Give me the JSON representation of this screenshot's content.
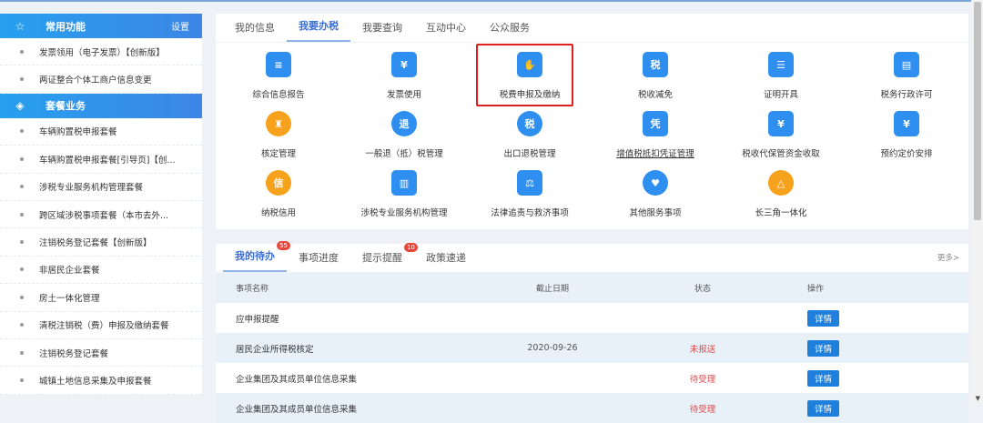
{
  "sidebar": {
    "common": {
      "title": "常用功能",
      "settings": "设置",
      "items": [
        "发票领用（电子发票）【创新版】",
        "两证整合个体工商户信息变更"
      ]
    },
    "packages": {
      "title": "套餐业务",
      "items": [
        "车辆购置税申报套餐",
        "车辆购置税申报套餐[引导页]【创...",
        "涉税专业服务机构管理套餐",
        "跨区域涉税事项套餐（本市去外...",
        "注销税务登记套餐【创新版】",
        "非居民企业套餐",
        "房土一体化管理",
        "清税注销税（费）申报及缴纳套餐",
        "注销税务登记套餐",
        "城镇土地信息采集及申报套餐"
      ]
    }
  },
  "services": {
    "tabs": [
      "我的信息",
      "我要办税",
      "我要查询",
      "互动中心",
      "公众服务"
    ],
    "active_tab": "我要办税",
    "items": [
      {
        "label": "综合信息报告",
        "icon": "report-icon",
        "glyph": "≡"
      },
      {
        "label": "发票使用",
        "icon": "invoice-icon",
        "glyph": "¥"
      },
      {
        "label": "税费申报及缴纳",
        "icon": "hand-coin-icon",
        "glyph": "✋"
      },
      {
        "label": "税收减免",
        "icon": "tax-reduction-icon",
        "glyph": "税"
      },
      {
        "label": "证明开具",
        "icon": "certificate-icon",
        "glyph": "☰"
      },
      {
        "label": "税务行政许可",
        "icon": "license-icon",
        "glyph": "▤"
      },
      {
        "label": "核定管理",
        "icon": "stamp-icon",
        "glyph": "♜"
      },
      {
        "label": "一般退（抵）税管理",
        "icon": "refund-icon",
        "glyph": "退"
      },
      {
        "label": "出口退税管理",
        "icon": "export-refund-icon",
        "glyph": "税"
      },
      {
        "label": "增值税抵扣凭证管理",
        "icon": "voucher-icon",
        "glyph": "凭"
      },
      {
        "label": "税收代保管资金收取",
        "icon": "inbox-icon",
        "glyph": "¥"
      },
      {
        "label": "预约定价安排",
        "icon": "calendar-icon",
        "glyph": "¥"
      },
      {
        "label": "纳税信用",
        "icon": "credit-medal-icon",
        "glyph": "信"
      },
      {
        "label": "涉税专业服务机构管理",
        "icon": "building-gear-icon",
        "glyph": "▥"
      },
      {
        "label": "法律追责与救济事项",
        "icon": "gavel-icon",
        "glyph": "⚖"
      },
      {
        "label": "其他服务事项",
        "icon": "heart-hands-icon",
        "glyph": "♥"
      },
      {
        "label": "长三角一体化",
        "icon": "triangle-icon",
        "glyph": "△"
      }
    ]
  },
  "todo": {
    "tabs": [
      {
        "label": "我的待办",
        "badge": "55"
      },
      {
        "label": "事项进度"
      },
      {
        "label": "提示提醒",
        "badge": "10"
      },
      {
        "label": "政策速递"
      }
    ],
    "more": "更多>",
    "columns": [
      "事项名称",
      "截止日期",
      "状态",
      "操作"
    ],
    "rows": [
      {
        "name": "应申报提醒",
        "date": "",
        "status": "",
        "action": "详情"
      },
      {
        "name": "居民企业所得税核定",
        "date": "2020-09-26",
        "status": "未报送",
        "action": "详情"
      },
      {
        "name": "企业集团及其成员单位信息采集",
        "date": "",
        "status": "待受理",
        "action": "详情"
      },
      {
        "name": "企业集团及其成员单位信息采集",
        "date": "",
        "status": "待受理",
        "action": "详情"
      }
    ]
  }
}
